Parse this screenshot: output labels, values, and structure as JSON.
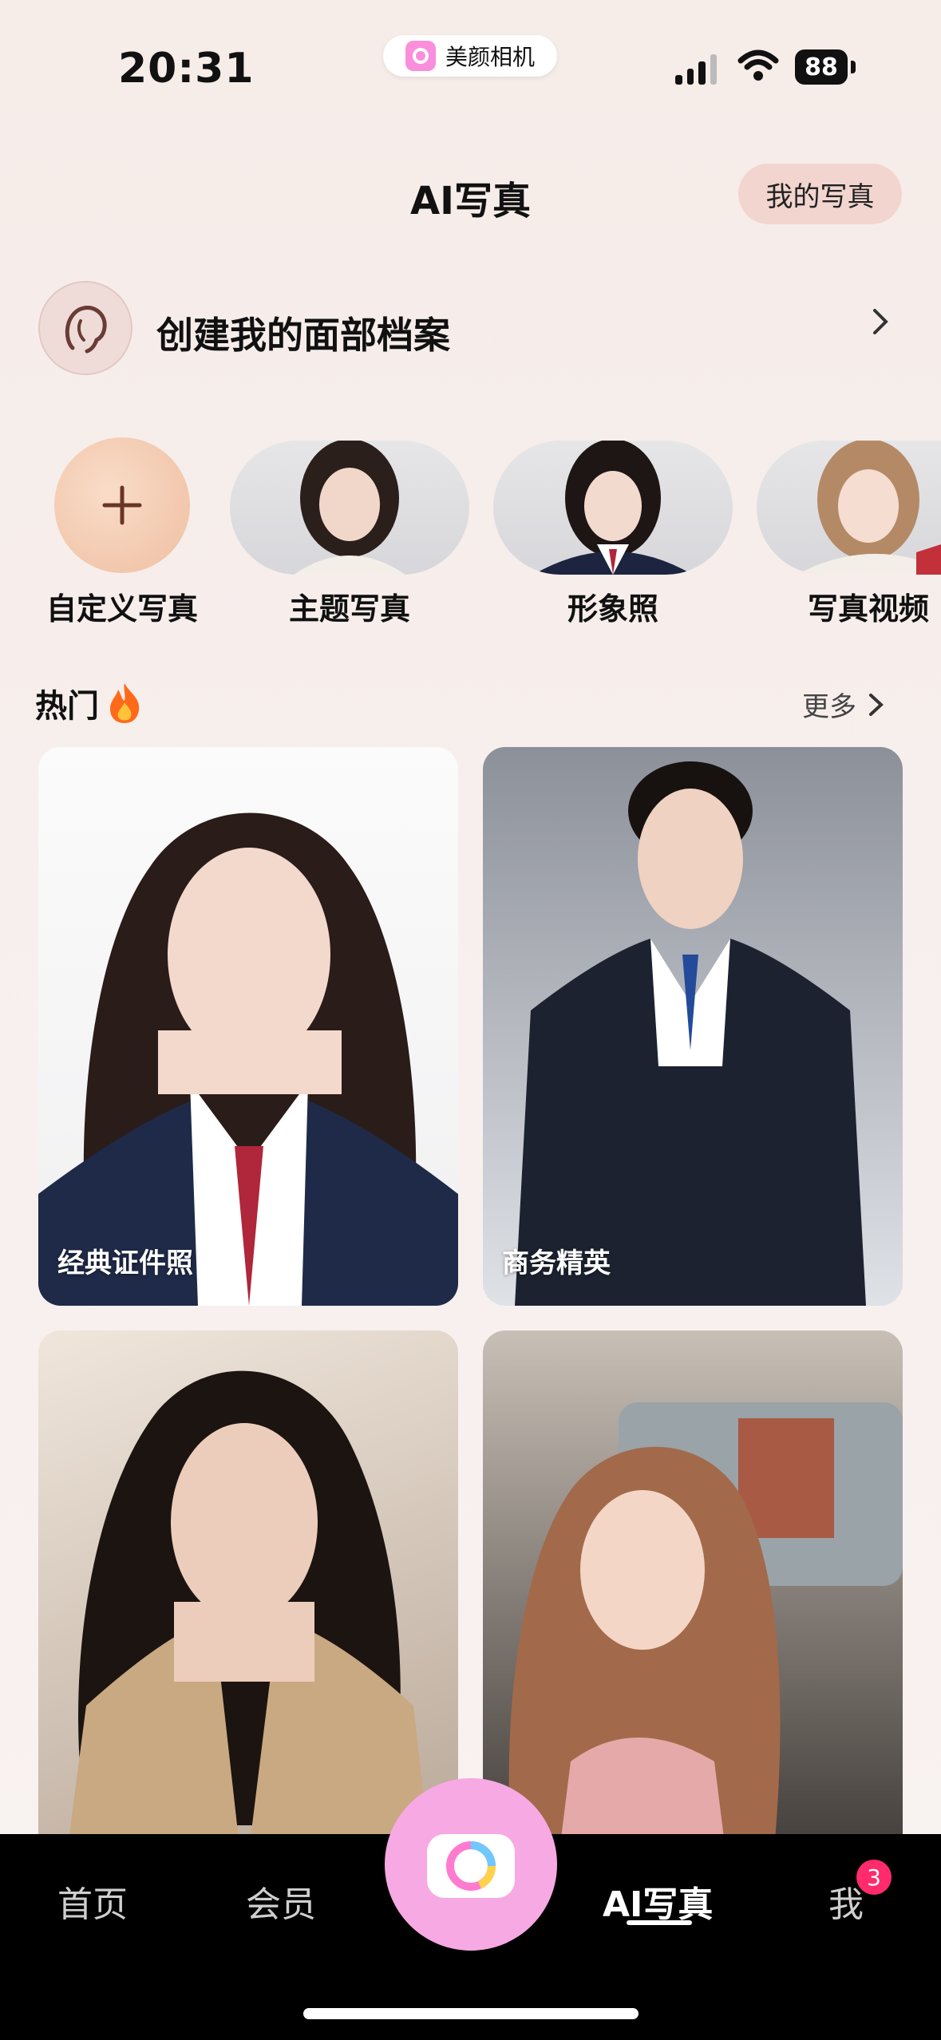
{
  "status_bar": {
    "time": "20:31",
    "app_name": "美颜相机",
    "battery": "88"
  },
  "header": {
    "title": "AI写真",
    "my_photos_label": "我的写真"
  },
  "face_profile": {
    "label": "创建我的面部档案"
  },
  "categories": [
    {
      "label": "自定义写真"
    },
    {
      "label": "主题写真"
    },
    {
      "label": "形象照"
    },
    {
      "label": "写真视频"
    }
  ],
  "hot_section": {
    "title": "热门",
    "more_label": "更多"
  },
  "cards": [
    {
      "label": "经典证件照"
    },
    {
      "label": "商务精英"
    }
  ],
  "tabbar": {
    "home": "首页",
    "member": "会员",
    "ai": "AI写真",
    "me": "我",
    "me_badge": "3"
  }
}
